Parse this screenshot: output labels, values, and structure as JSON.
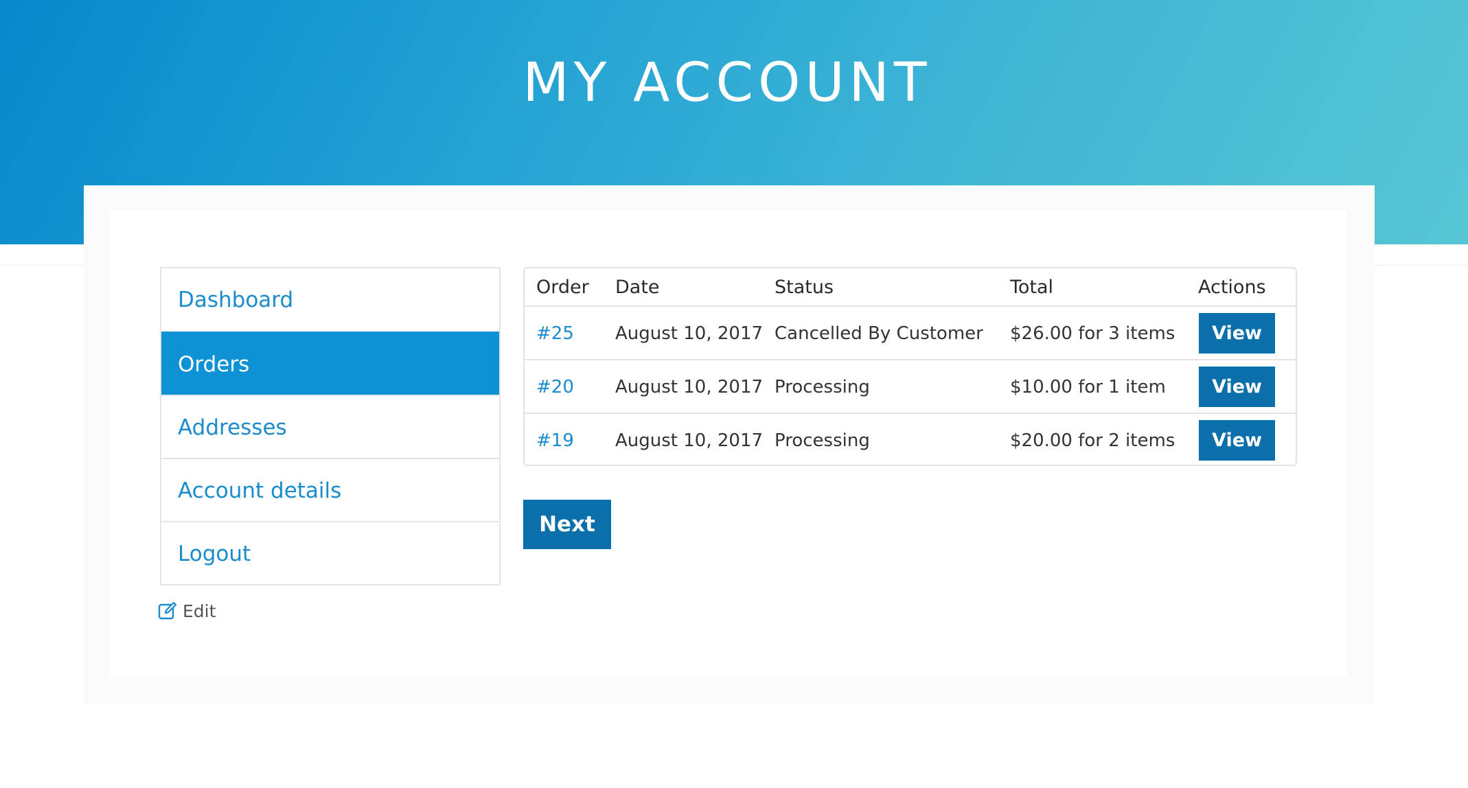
{
  "header": {
    "title": "MY ACCOUNT"
  },
  "sidebar": {
    "items": [
      {
        "label": "Dashboard",
        "active": false
      },
      {
        "label": "Orders",
        "active": true
      },
      {
        "label": "Addresses",
        "active": false
      },
      {
        "label": "Account details",
        "active": false
      },
      {
        "label": "Logout",
        "active": false
      }
    ],
    "edit_label": "Edit",
    "edit_icon": "edit-icon"
  },
  "orders_table": {
    "columns": [
      "Order",
      "Date",
      "Status",
      "Total",
      "Actions"
    ],
    "rows": [
      {
        "order": "#25",
        "date": "August 10, 2017",
        "status": "Cancelled By Customer",
        "total": "$26.00 for 3 items",
        "action": "View"
      },
      {
        "order": "#20",
        "date": "August 10, 2017",
        "status": "Processing",
        "total": "$10.00 for 1 item",
        "action": "View"
      },
      {
        "order": "#19",
        "date": "August 10, 2017",
        "status": "Processing",
        "total": "$20.00 for 2 items",
        "action": "View"
      }
    ]
  },
  "pagination": {
    "next_label": "Next"
  },
  "colors": {
    "accent": "#0d93d5",
    "button": "#0b6fac",
    "link": "#1a8ccd",
    "hero_start": "#0788cb",
    "hero_end": "#56c6d4"
  }
}
